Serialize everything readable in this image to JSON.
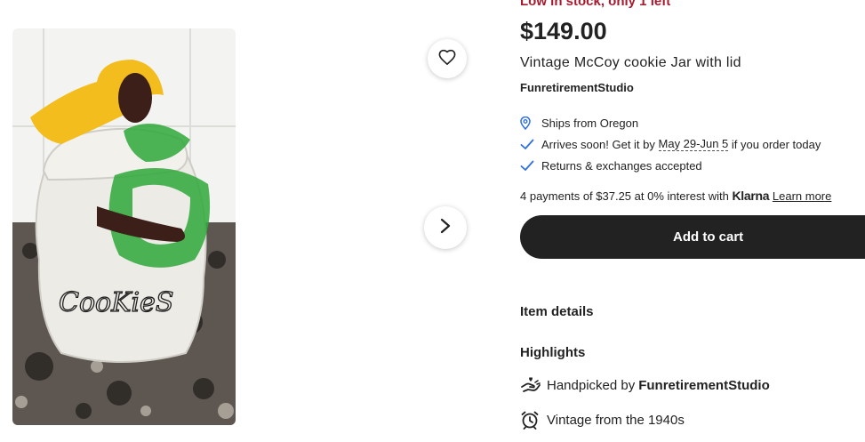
{
  "product": {
    "stock_notice": "Low in stock, only 1 left",
    "price": "$149.00",
    "title": "Vintage McCoy cookie Jar with lid",
    "shop_name": "FunretirementStudio"
  },
  "shipping": {
    "ships_from": "Ships from Oregon",
    "arrives_prefix": "Arrives soon! Get it by",
    "arrives_dates": "May 29-Jun 5",
    "arrives_suffix": "if you order today",
    "returns": "Returns & exchanges accepted"
  },
  "payments": {
    "text": "4 payments of $37.25 at 0% interest with",
    "provider": "Klarna",
    "learn_more": "Learn more"
  },
  "add_to_cart_label": "Add to cart",
  "item_details_label": "Item details",
  "highlights": {
    "heading": "Highlights",
    "handpicked_prefix": "Handpicked by",
    "handpicked_shop": "FunretirementStudio",
    "vintage": "Vintage from the 1940s"
  },
  "photo": {
    "jar_text": "CooKieS"
  },
  "icons": {
    "favorite": "heart-icon",
    "next": "chevron-right-icon",
    "location": "location-pin-icon",
    "check": "check-icon",
    "handpicked": "hand-heart-icon",
    "vintage": "alarm-clock-icon"
  },
  "colors": {
    "stock_notice": "#a61a2e",
    "button": "#222222",
    "check": "#2f6fdd"
  }
}
